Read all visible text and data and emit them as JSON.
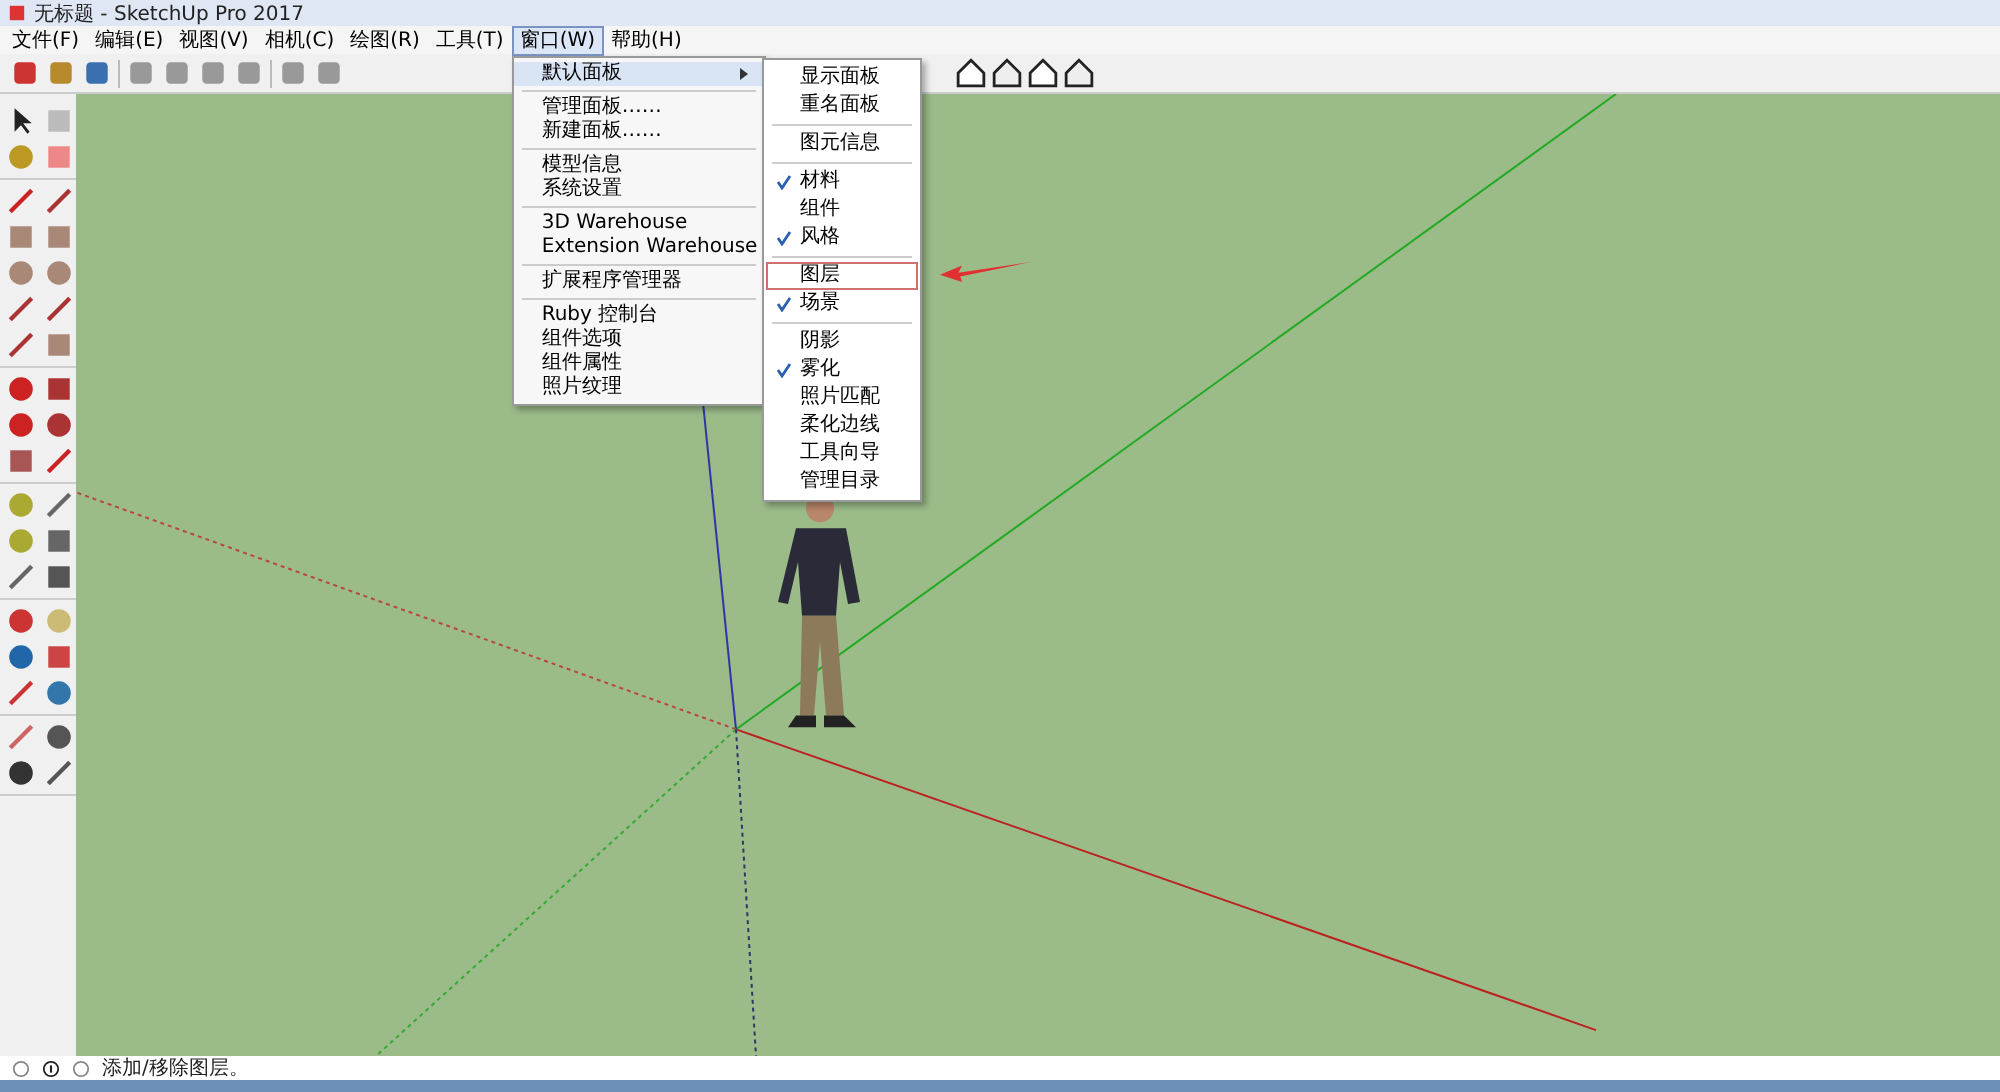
{
  "window": {
    "title": "无标题 - SketchUp Pro 2017"
  },
  "menu_bar": [
    {
      "label": "文件(F)",
      "selected": false
    },
    {
      "label": "编辑(E)",
      "selected": false
    },
    {
      "label": "视图(V)",
      "selected": false
    },
    {
      "label": "相机(C)",
      "selected": false
    },
    {
      "label": "绘图(R)",
      "selected": false
    },
    {
      "label": "工具(T)",
      "selected": false
    },
    {
      "label": "窗口(W)",
      "selected": true
    },
    {
      "label": "帮助(H)",
      "selected": false
    }
  ],
  "window_menu": {
    "groups": [
      [
        {
          "label": "默认面板",
          "has_submenu": true,
          "selected": true
        }
      ],
      [
        {
          "label": "管理面板……",
          "has_submenu": false,
          "selected": false
        },
        {
          "label": "新建面板……",
          "has_submenu": false,
          "selected": false
        }
      ],
      [
        {
          "label": "模型信息",
          "has_submenu": false,
          "selected": false
        },
        {
          "label": "系统设置",
          "has_submenu": false,
          "selected": false
        }
      ],
      [
        {
          "label": "3D Warehouse",
          "has_submenu": false,
          "selected": false
        },
        {
          "label": "Extension Warehouse",
          "has_submenu": false,
          "selected": false
        }
      ],
      [
        {
          "label": "扩展程序管理器",
          "has_submenu": false,
          "selected": false
        }
      ],
      [
        {
          "label": "Ruby 控制台",
          "has_submenu": false,
          "selected": false
        },
        {
          "label": "组件选项",
          "has_submenu": false,
          "selected": false
        },
        {
          "label": "组件属性",
          "has_submenu": false,
          "selected": false
        },
        {
          "label": "照片纹理",
          "has_submenu": false,
          "selected": false
        }
      ]
    ]
  },
  "panels_submenu": {
    "groups": [
      [
        {
          "label": "显示面板",
          "checked": false,
          "highlighted": false
        },
        {
          "label": "重名面板",
          "checked": false,
          "highlighted": false
        }
      ],
      [
        {
          "label": "图元信息",
          "checked": false,
          "highlighted": false
        }
      ],
      [
        {
          "label": "材料",
          "checked": true,
          "highlighted": false
        },
        {
          "label": "组件",
          "checked": false,
          "highlighted": false
        },
        {
          "label": "风格",
          "checked": true,
          "highlighted": false
        }
      ],
      [
        {
          "label": "图层",
          "checked": false,
          "highlighted": true
        },
        {
          "label": "场景",
          "checked": true,
          "highlighted": false
        }
      ],
      [
        {
          "label": "阴影",
          "checked": false,
          "highlighted": false
        },
        {
          "label": "雾化",
          "checked": true,
          "highlighted": false
        },
        {
          "label": "照片匹配",
          "checked": false,
          "highlighted": false
        },
        {
          "label": "柔化边线",
          "checked": false,
          "highlighted": false
        },
        {
          "label": "工具向导",
          "checked": false,
          "highlighted": false
        },
        {
          "label": "管理目录",
          "checked": false,
          "highlighted": false
        }
      ]
    ]
  },
  "status_bar": {
    "text": "添加/移除图层。"
  }
}
